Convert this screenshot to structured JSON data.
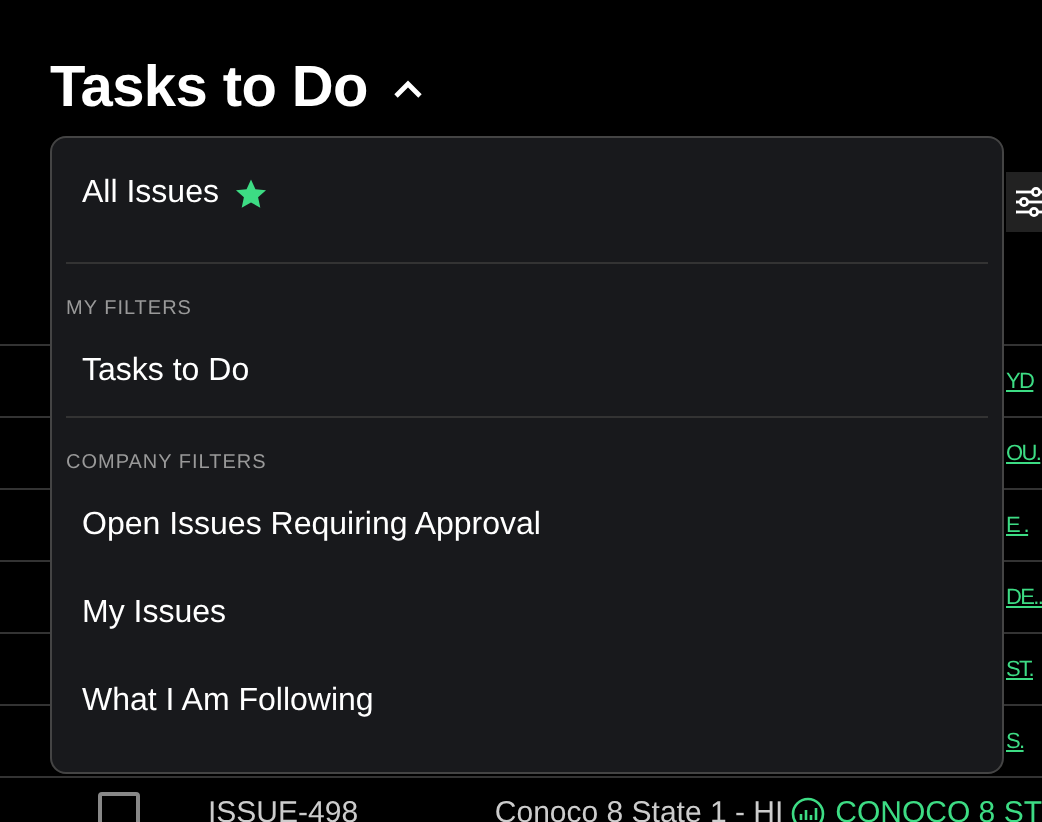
{
  "title": "Tasks to Do",
  "title_expanded": true,
  "menu": {
    "items": [
      {
        "kind": "item",
        "label": "All Issues",
        "starred": true
      },
      {
        "kind": "divider"
      },
      {
        "kind": "header",
        "label": "MY FILTERS"
      },
      {
        "kind": "item",
        "label": "Tasks to Do",
        "starred": false
      },
      {
        "kind": "divider"
      },
      {
        "kind": "header",
        "label": "COMPANY FILTERS"
      },
      {
        "kind": "item",
        "label": "Open Issues Requiring Approval",
        "starred": false
      },
      {
        "kind": "item",
        "label": "My Issues",
        "starred": false
      },
      {
        "kind": "item",
        "label": "What I Am Following",
        "starred": false
      }
    ]
  },
  "table": {
    "rows": [
      {
        "kind": "partial",
        "link": "YD"
      },
      {
        "kind": "partial",
        "link": "OU."
      },
      {
        "kind": "partial",
        "link": "E ."
      },
      {
        "kind": "partial",
        "link": "DE.."
      },
      {
        "kind": "partial",
        "link": "ST."
      },
      {
        "kind": "partial",
        "link": "S."
      },
      {
        "kind": "full",
        "checked": false,
        "id": "ISSUE-498",
        "name": "Conoco 8 State 1 - HI",
        "link": "CONOCO 8 ST"
      }
    ]
  }
}
